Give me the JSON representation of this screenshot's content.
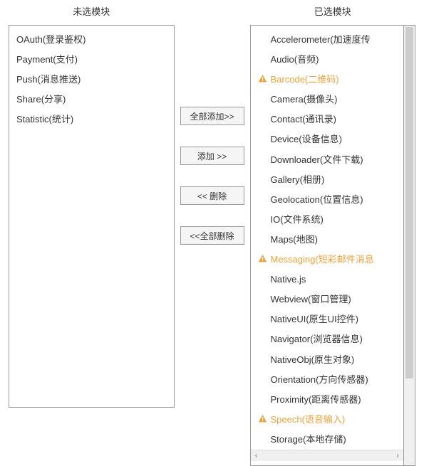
{
  "left": {
    "title": "未选模块",
    "items": [
      {
        "label": "OAuth(登录鉴权)",
        "warn": false
      },
      {
        "label": "Payment(支付)",
        "warn": false
      },
      {
        "label": "Push(消息推送)",
        "warn": false
      },
      {
        "label": "Share(分享)",
        "warn": false
      },
      {
        "label": "Statistic(统计)",
        "warn": false
      }
    ]
  },
  "right": {
    "title": "已选模块",
    "items": [
      {
        "label": "Accelerometer(加速度传",
        "warn": false
      },
      {
        "label": "Audio(音频)",
        "warn": false
      },
      {
        "label": "Barcode(二维码)",
        "warn": true
      },
      {
        "label": "Camera(摄像头)",
        "warn": false
      },
      {
        "label": "Contact(通讯录)",
        "warn": false
      },
      {
        "label": "Device(设备信息)",
        "warn": false
      },
      {
        "label": "Downloader(文件下载)",
        "warn": false
      },
      {
        "label": "Gallery(相册)",
        "warn": false
      },
      {
        "label": "Geolocation(位置信息)",
        "warn": false
      },
      {
        "label": "IO(文件系统)",
        "warn": false
      },
      {
        "label": "Maps(地图)",
        "warn": false
      },
      {
        "label": "Messaging(短彩邮件消息",
        "warn": true
      },
      {
        "label": "Native.js",
        "warn": false
      },
      {
        "label": "Webview(窗口管理)",
        "warn": false
      },
      {
        "label": "NativeUI(原生UI控件)",
        "warn": false
      },
      {
        "label": "Navigator(浏览器信息)",
        "warn": false
      },
      {
        "label": "NativeObj(原生对象)",
        "warn": false
      },
      {
        "label": "Orientation(方向传感器)",
        "warn": false
      },
      {
        "label": "Proximity(距离传感器)",
        "warn": false
      },
      {
        "label": "Speech(语音输入)",
        "warn": true
      },
      {
        "label": "Storage(本地存储)",
        "warn": false
      }
    ]
  },
  "buttons": {
    "add_all": "全部添加>>",
    "add": "添加 >>",
    "remove": "<< 删除",
    "remove_all": "<<全部删除"
  }
}
